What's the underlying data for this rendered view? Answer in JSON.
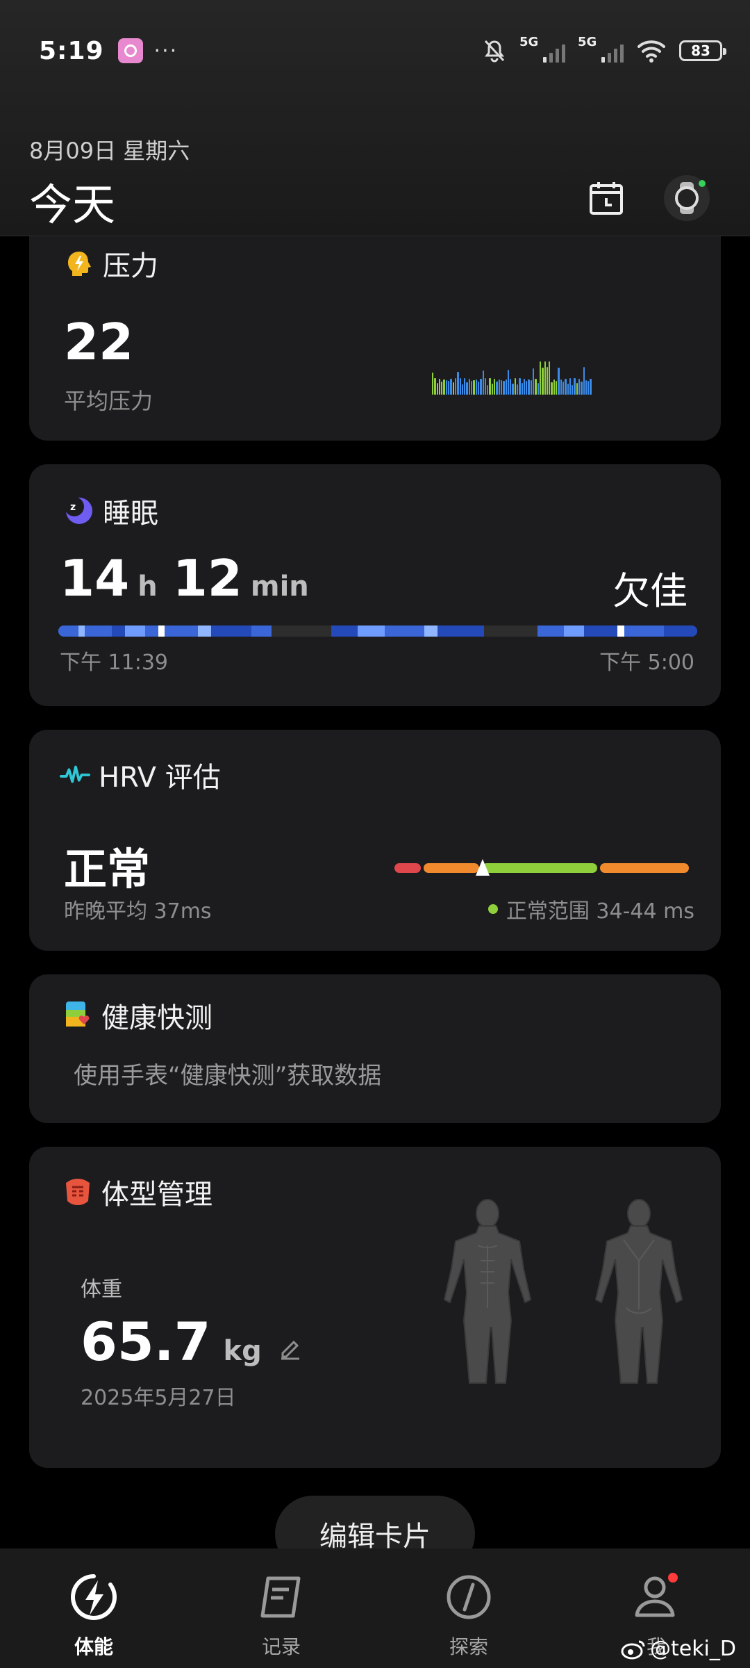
{
  "status_bar": {
    "time": "5:19",
    "dots": "···",
    "net1": "5G",
    "net2": "5G",
    "battery": "83"
  },
  "header": {
    "date": "8月09日 星期六",
    "title": "今天"
  },
  "stress_card": {
    "title": "压力",
    "value": "22",
    "caption": "平均压力",
    "icon": "lightning-head-icon"
  },
  "sleep_card": {
    "title": "睡眠",
    "hours": "14",
    "hours_unit": "h",
    "minutes": "12",
    "minutes_unit": "min",
    "rating": "欠佳",
    "start_time": "下午 11:39",
    "end_time": "下午 5:00",
    "icon": "moon-icon"
  },
  "hrv_card": {
    "title": "HRV 评估",
    "status": "正常",
    "caption": "昨晚平均 37ms",
    "range_text": "正常范围 34-44 ms",
    "marker_fraction": 0.3,
    "icon": "heartbeat-wave-icon"
  },
  "quick_check_card": {
    "title": "健康快测",
    "description": "使用手表“健康快测”获取数据",
    "icon": "health-check-icon"
  },
  "body_card": {
    "title": "体型管理",
    "weight_label": "体重",
    "weight_value": "65.7",
    "weight_unit": "kg",
    "date": "2025年5月27日",
    "icon": "body-shape-icon"
  },
  "edit_button": "编辑卡片",
  "bottom_nav": [
    {
      "label": "体能",
      "icon": "fitness-bolt-icon",
      "active": true
    },
    {
      "label": "记录",
      "icon": "record-icon",
      "active": false
    },
    {
      "label": "探索",
      "icon": "compass-icon",
      "active": false
    },
    {
      "label": "我",
      "icon": "profile-icon",
      "active": false
    }
  ],
  "watermark": "@teki_D",
  "colors": {
    "background": "#000000",
    "card": "#1c1c1e",
    "sleep_blue": "#3a66d8",
    "hrv_red": "#e0474c",
    "hrv_orange": "#f08a2c",
    "hrv_green": "#8fcf3c",
    "notification_red": "#ff3b3b"
  }
}
